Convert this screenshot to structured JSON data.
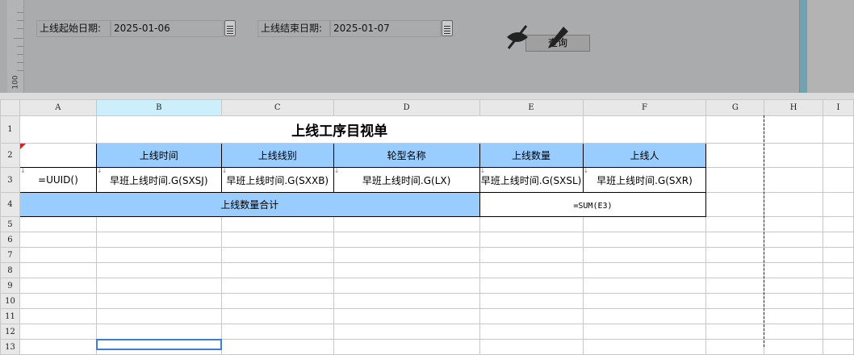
{
  "query_panel": {
    "start_label": "上线起始日期:",
    "start_value": "2025-01-06",
    "end_label": "上线结束日期:",
    "end_value": "2025-01-07",
    "query_button": "查询",
    "ruler_label": "100"
  },
  "sheet": {
    "columns": [
      "A",
      "B",
      "C",
      "D",
      "E",
      "F",
      "G",
      "H",
      "I"
    ],
    "rows": [
      "1",
      "2",
      "3",
      "4",
      "5",
      "6",
      "7",
      "8",
      "9",
      "10",
      "11",
      "12",
      "13"
    ],
    "title": "上线工序目视单",
    "headers": [
      "上线时间",
      "上线线别",
      "轮型名称",
      "上线数量",
      "上线人"
    ],
    "row3": [
      "=UUID()",
      "早班上线时间.G(SXSJ)",
      "早班上线时间.G(SXXB)",
      "早班上线时间.G(LX)",
      "早班上线时间.G(SXSL)",
      "早班上线时间.G(SXR)"
    ],
    "total_label": "上线数量合计",
    "total_formula": "=SUM(E3)",
    "header_fill": "#99ccff"
  }
}
